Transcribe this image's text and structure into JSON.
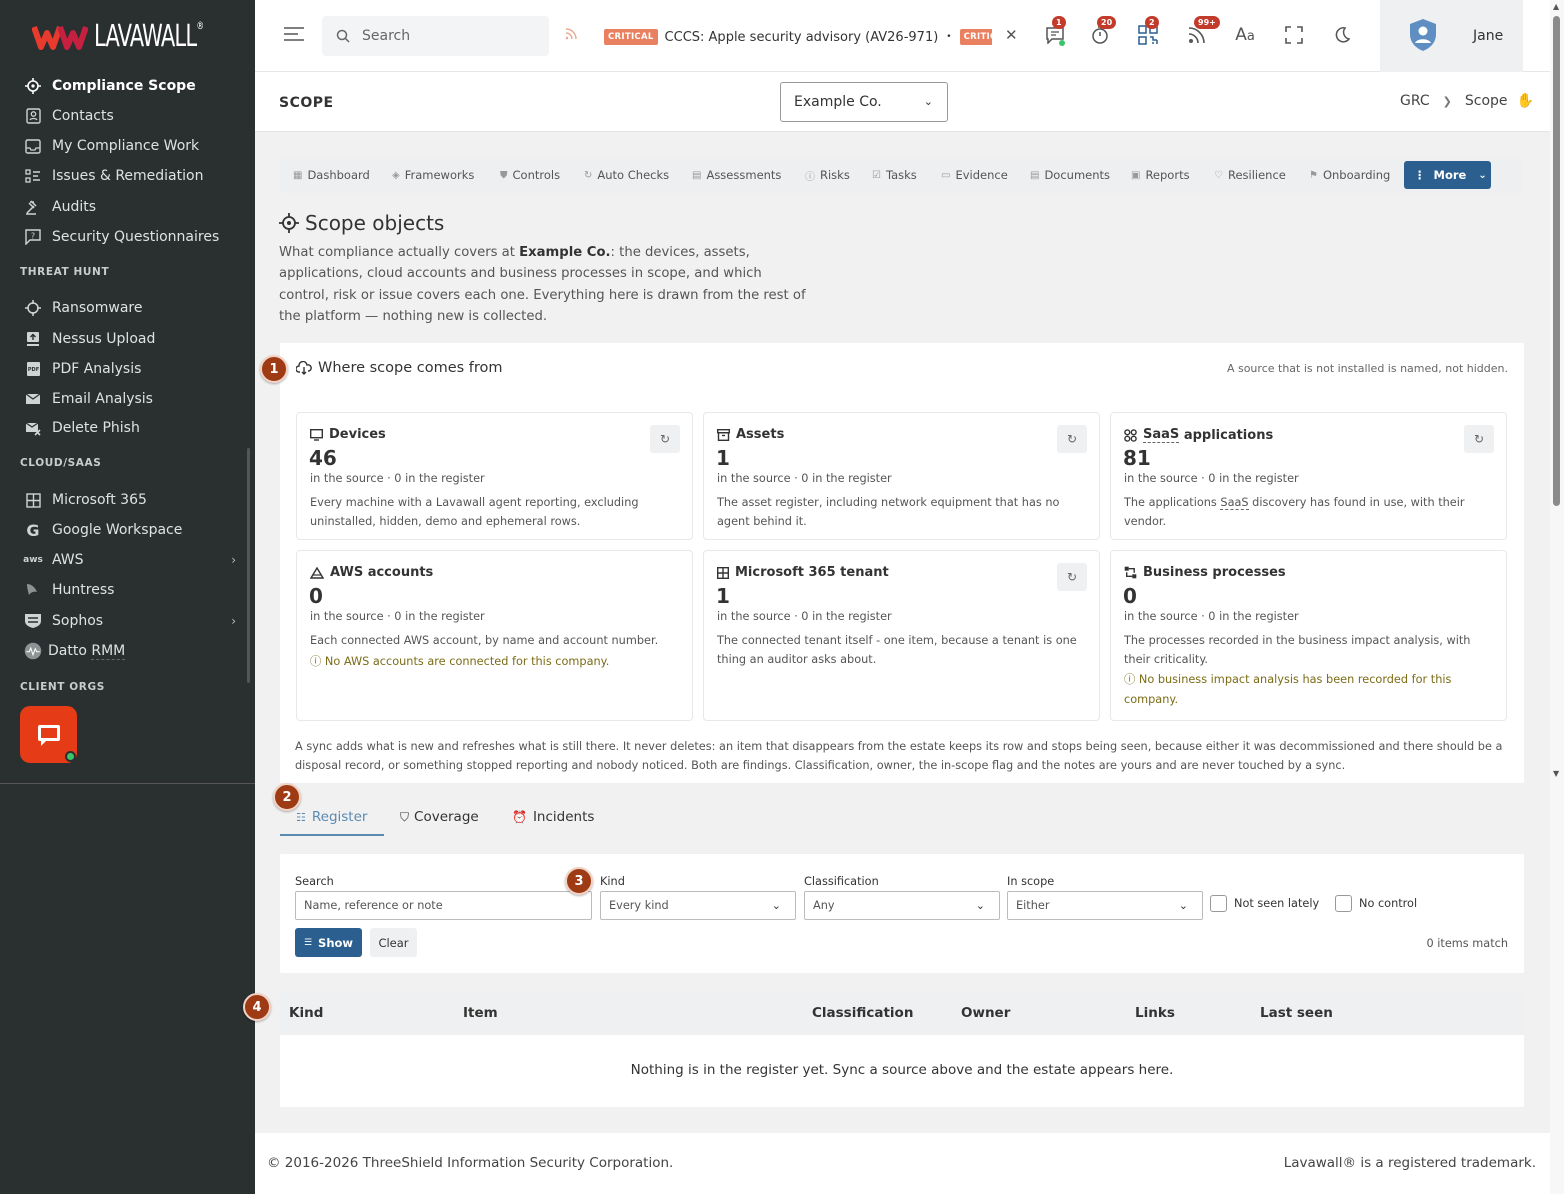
{
  "brand": {
    "name": "LAVAWALL",
    "reg": "®"
  },
  "sidebar": {
    "items": [
      {
        "label": "Compliance Scope"
      },
      {
        "label": "Contacts"
      },
      {
        "label": "My Compliance Work"
      },
      {
        "label": "Issues & Remediation"
      },
      {
        "label": "Audits"
      },
      {
        "label": "Security Questionnaires"
      }
    ],
    "threat_head": "THREAT HUNT",
    "threat_items": [
      {
        "label": "Ransomware"
      },
      {
        "label": "Nessus Upload"
      },
      {
        "label": "PDF Analysis"
      },
      {
        "label": "Email Analysis"
      },
      {
        "label": "Delete Phish"
      }
    ],
    "cloud_head": "CLOUD/SAAS",
    "cloud_items": [
      {
        "label": "Microsoft 365"
      },
      {
        "label": "Google Workspace"
      },
      {
        "label": "AWS"
      },
      {
        "label": "Huntress"
      },
      {
        "label": "Sophos"
      },
      {
        "label": "Datto",
        "label2": "RMM"
      }
    ],
    "client_head": "CLIENT ORGS"
  },
  "topbar": {
    "search_placeholder": "Search",
    "ticker_badge": "CRITICAL",
    "ticker_text": "CCCS: Apple security advisory (AV26-971)",
    "ticker_badge2": "CRITICAL",
    "badges": {
      "messages": "1",
      "timer": "20",
      "qr": "2",
      "feeds": "99+"
    },
    "user_name": "Jane"
  },
  "page": {
    "title": "SCOPE",
    "company": "Example Co.",
    "breadcrumb": [
      "GRC",
      "Scope"
    ]
  },
  "tabs": [
    "Dashboard",
    "Frameworks",
    "Controls",
    "Auto Checks",
    "Assessments",
    "Risks",
    "Tasks",
    "Evidence",
    "Documents",
    "Reports",
    "Resilience",
    "Onboarding"
  ],
  "more_label": "More",
  "scope": {
    "heading": "Scope objects",
    "desc_pre": "What compliance actually covers at ",
    "desc_company": "Example Co.",
    "desc_post": ": the devices, assets, applications, cloud accounts and business processes in scope, and which control, risk or issue covers each one. Everything here is drawn from the rest of the platform — nothing new is collected."
  },
  "sources": {
    "step": "1",
    "title": "Where scope comes from",
    "note": "A source that is not installed is named, not hidden.",
    "cards": [
      {
        "title": "Devices",
        "count": "46",
        "sub": "in the source · 0 in the register",
        "desc": "Every machine with a Lavawall agent reporting, excluding uninstalled, hidden, demo and ephemeral rows."
      },
      {
        "title": "Assets",
        "count": "1",
        "sub": "in the source · 0 in the register",
        "desc": "The asset register, including network equipment that has no agent behind it."
      },
      {
        "title_a": "SaaS",
        "title_b": "applications",
        "count": "81",
        "sub": "in the source · 0 in the register",
        "desc_a": "The applications ",
        "desc_b": "SaaS",
        "desc_c": " discovery has found in use, with their vendor."
      },
      {
        "title": "AWS accounts",
        "count": "0",
        "sub": "in the source · 0 in the register",
        "desc": "Each connected AWS account, by name and account number.",
        "warn": "No AWS accounts are connected for this company."
      },
      {
        "title": "Microsoft 365 tenant",
        "count": "1",
        "sub": "in the source · 0 in the register",
        "desc": "The connected tenant itself - one item, because a tenant is one thing an auditor asks about."
      },
      {
        "title": "Business processes",
        "count": "0",
        "sub": "in the source · 0 in the register",
        "desc": "The processes recorded in the business impact analysis, with their criticality.",
        "warn": "No business impact analysis has been recorded for this company."
      }
    ],
    "sync_note": "A sync adds what is new and refreshes what is still there. It never deletes: an item that disappears from the estate keeps its row and stops being seen, because either it was decommissioned and there should be a disposal record, or something stopped reporting and nobody noticed. Both are findings. Classification, owner, the in-scope flag and the notes are yours and are never touched by a sync."
  },
  "subtabs": {
    "step": "2",
    "items": [
      "Register",
      "Coverage",
      "Incidents"
    ]
  },
  "filters": {
    "step": "3",
    "search_label": "Search",
    "search_placeholder": "Name, reference or note",
    "kind_label": "Kind",
    "kind_value": "Every kind",
    "class_label": "Classification",
    "class_value": "Any",
    "scope_label": "In scope",
    "scope_value": "Either",
    "chk1": "Not seen lately",
    "chk2": "No control",
    "show": "Show",
    "clear": "Clear",
    "match": "0 items match"
  },
  "table": {
    "step": "4",
    "columns": [
      "Kind",
      "Item",
      "Classification",
      "Owner",
      "Links",
      "Last seen"
    ],
    "empty": "Nothing is in the register yet. Sync a source above and the estate appears here."
  },
  "footer": {
    "left": "© 2016-2026 ThreeShield Information Security Corporation.",
    "right": "Lavawall® is a registered trademark."
  },
  "colors": {
    "accent": "#2b5f8f",
    "sidebar": "#2a2f30",
    "step": "#9e3a14",
    "critical": "#e9805f"
  }
}
